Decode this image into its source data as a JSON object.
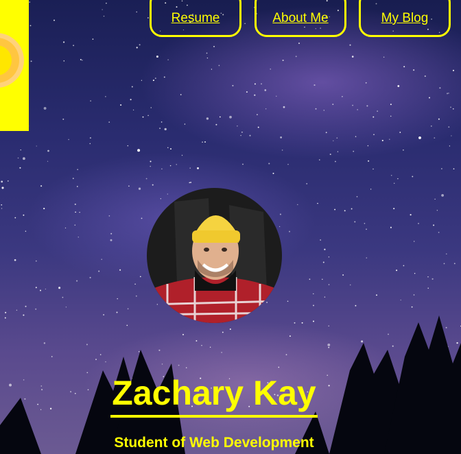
{
  "nav": {
    "items": [
      {
        "label": "Resume"
      },
      {
        "label": "About Me"
      },
      {
        "label": "My Blog"
      }
    ]
  },
  "hero": {
    "name": "Zachary Kay",
    "subtitle": "Student of Web Development"
  },
  "colors": {
    "accent": "#ffff00",
    "sky_dark": "#1a1f55",
    "sky_light": "#6b5a92"
  },
  "icons": {
    "logo": "sun-logo-icon"
  }
}
